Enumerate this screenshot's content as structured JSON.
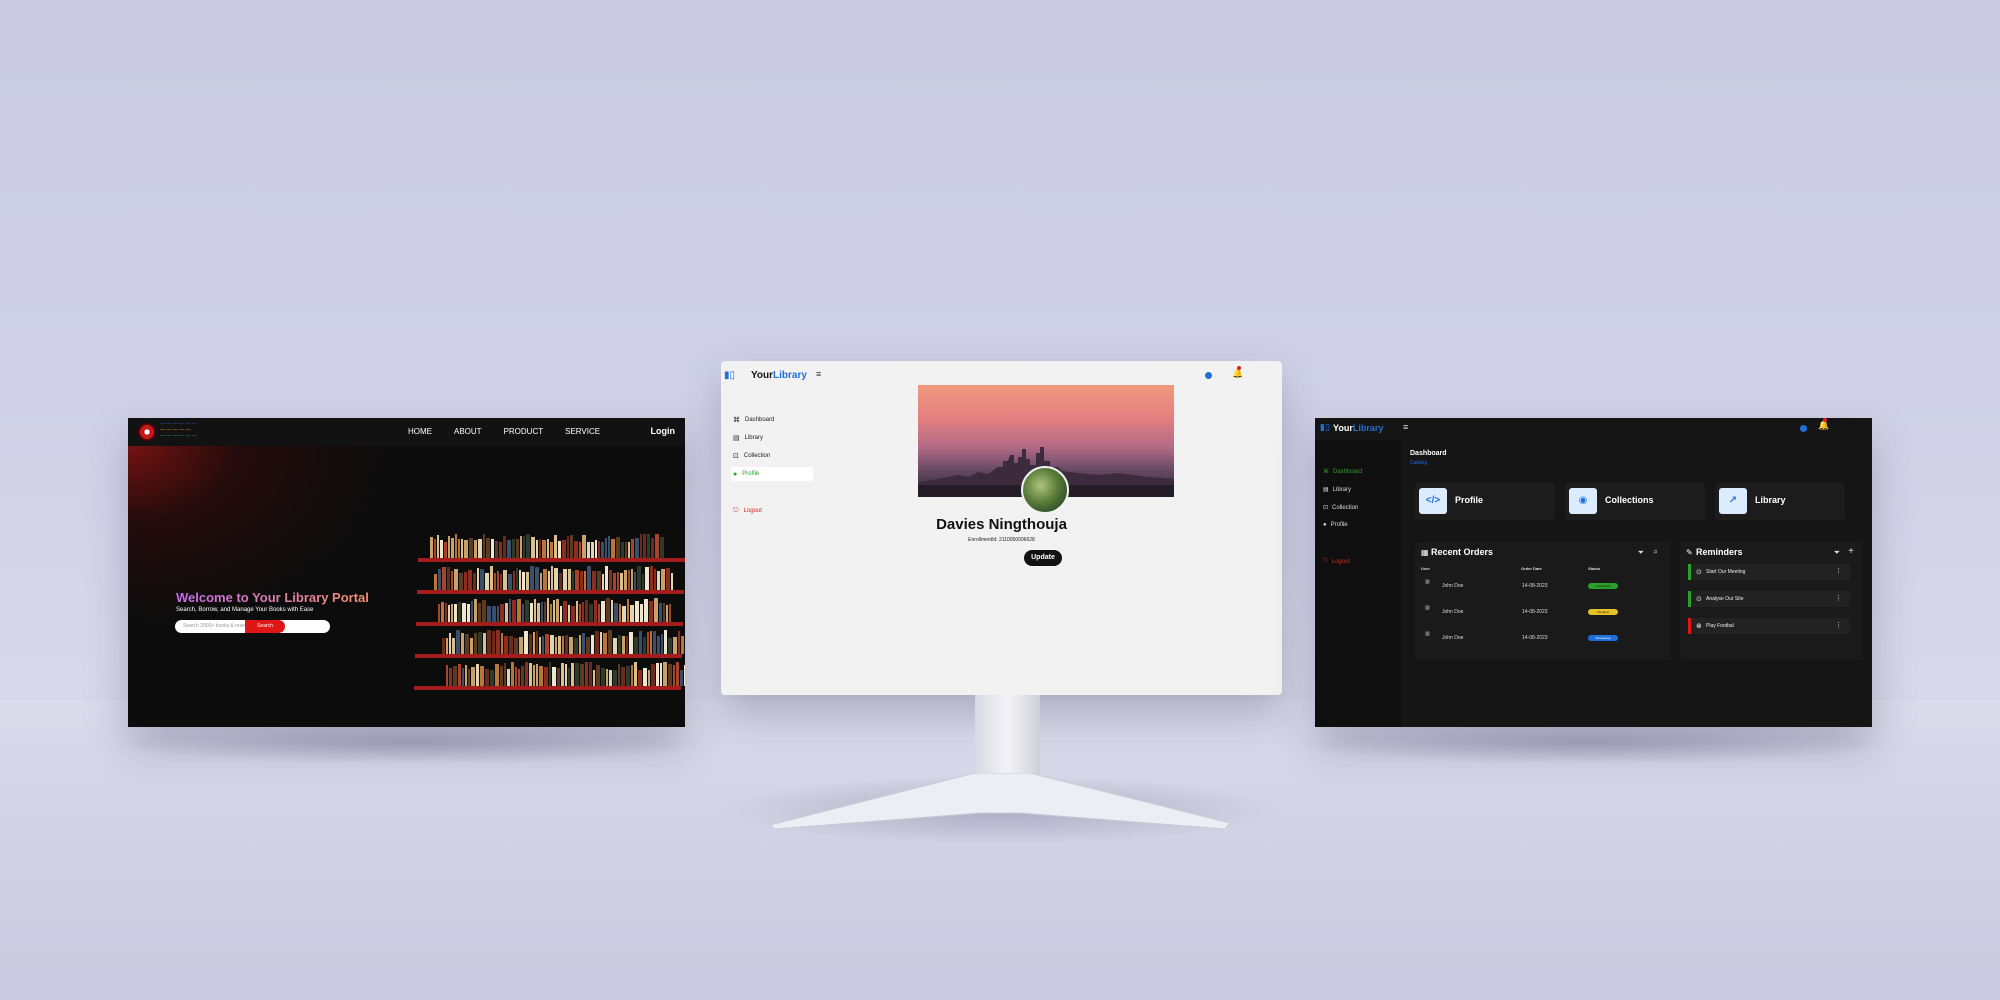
{
  "left_screen": {
    "nav": {
      "home": "HOME",
      "about": "ABOUT",
      "product": "PRODUCT",
      "service": "SERVICE",
      "login": "Login"
    },
    "hero": {
      "title": "Welcome to Your Library Portal",
      "subtitle": "Search, Borrow, and Manage Your Books with Ease",
      "search_placeholder": "Search 2000+ books & research articles",
      "search_button": "Search"
    }
  },
  "center_screen": {
    "brand_prefix": "Your",
    "brand_suffix": "Library",
    "sidebar": {
      "dashboard": "Dashboard",
      "library": "Library",
      "collection": "Collection",
      "profile": "Profile",
      "logout": "Logout"
    },
    "profile": {
      "name": "Davies Ningthouja",
      "enrollment": "EnrollmentId: 2110050006628",
      "update_button": "Update"
    }
  },
  "right_screen": {
    "brand_prefix": "Your",
    "brand_suffix": "Library",
    "sidebar": {
      "dashboard": "Dashboard",
      "library": "Library",
      "collection": "Collection",
      "profile": "Profile",
      "logout": "Logout"
    },
    "header": {
      "title": "Dashboard",
      "sub": "Catalog"
    },
    "cards": {
      "profile": "Profile",
      "collections": "Collections",
      "library": "Library"
    },
    "orders": {
      "title": "Recent Orders",
      "columns": [
        "User",
        "Order Date",
        "Status"
      ],
      "rows": [
        {
          "user": "John Doe",
          "date": "14-08-2023",
          "status": "Completed"
        },
        {
          "user": "John Doe",
          "date": "14-08-2023",
          "status": "Pending"
        },
        {
          "user": "John Doe",
          "date": "14-08-2023",
          "status": "Processing"
        }
      ]
    },
    "reminders": {
      "title": "Reminders",
      "items": [
        "Start Our Meeting",
        "Analyse Our Site",
        "Play Footbal"
      ]
    }
  },
  "colors": {
    "accent": "#1e6fd9",
    "danger": "#e01515",
    "success": "#2aa02a"
  }
}
